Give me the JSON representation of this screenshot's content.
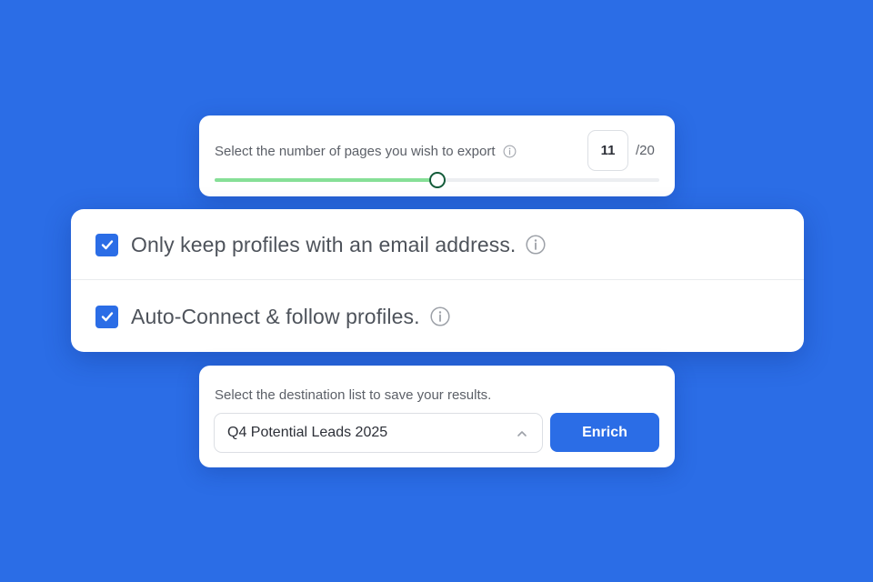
{
  "export_pages": {
    "label": "Select the number of pages you wish to export",
    "value": "11",
    "total": "/20",
    "slider_fraction": 0.5
  },
  "options": [
    {
      "label": "Only keep profiles with an email address.",
      "checked": true
    },
    {
      "label": "Auto-Connect & follow profiles.",
      "checked": true
    }
  ],
  "destination": {
    "label": "Select the destination list to save your results.",
    "selected_list": "Q4 Potential Leads 2025",
    "action_label": "Enrich"
  },
  "colors": {
    "background": "#2b6de6",
    "accent": "#2b6de6",
    "slider_fill": "#86df97",
    "slider_thumb_border": "#145c3a"
  },
  "icons": [
    "info-icon",
    "check-icon",
    "chevron-up-icon"
  ]
}
